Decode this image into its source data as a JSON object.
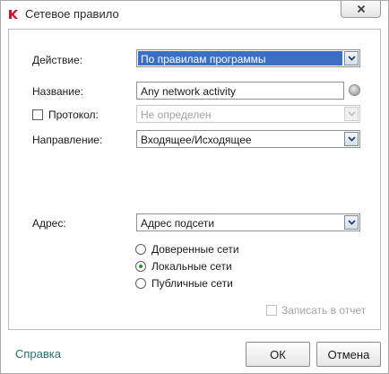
{
  "window": {
    "title": "Сетевое правило"
  },
  "form": {
    "action_label": "Действие:",
    "action_value": "По правилам программы",
    "name_label": "Название:",
    "name_value": "Any network activity",
    "protocol_label": "Протокол:",
    "protocol_value": "Не определен",
    "direction_label": "Направление:",
    "direction_value": "Входящее/Исходящее",
    "address_label": "Адрес:",
    "address_value": "Адрес подсети",
    "radio_options": [
      {
        "label": "Доверенные сети",
        "checked": false
      },
      {
        "label": "Локальные сети",
        "checked": true
      },
      {
        "label": "Публичные сети",
        "checked": false
      }
    ],
    "log_label": "Записать в отчет"
  },
  "footer": {
    "help_link": "Справка",
    "ok_label": "ОК",
    "cancel_label": "Отмена"
  },
  "colors": {
    "selection": "#3a6fc4",
    "link": "#2b6e6e",
    "radio_dot": "#2f8a2f",
    "app_icon": "#c8102e"
  }
}
